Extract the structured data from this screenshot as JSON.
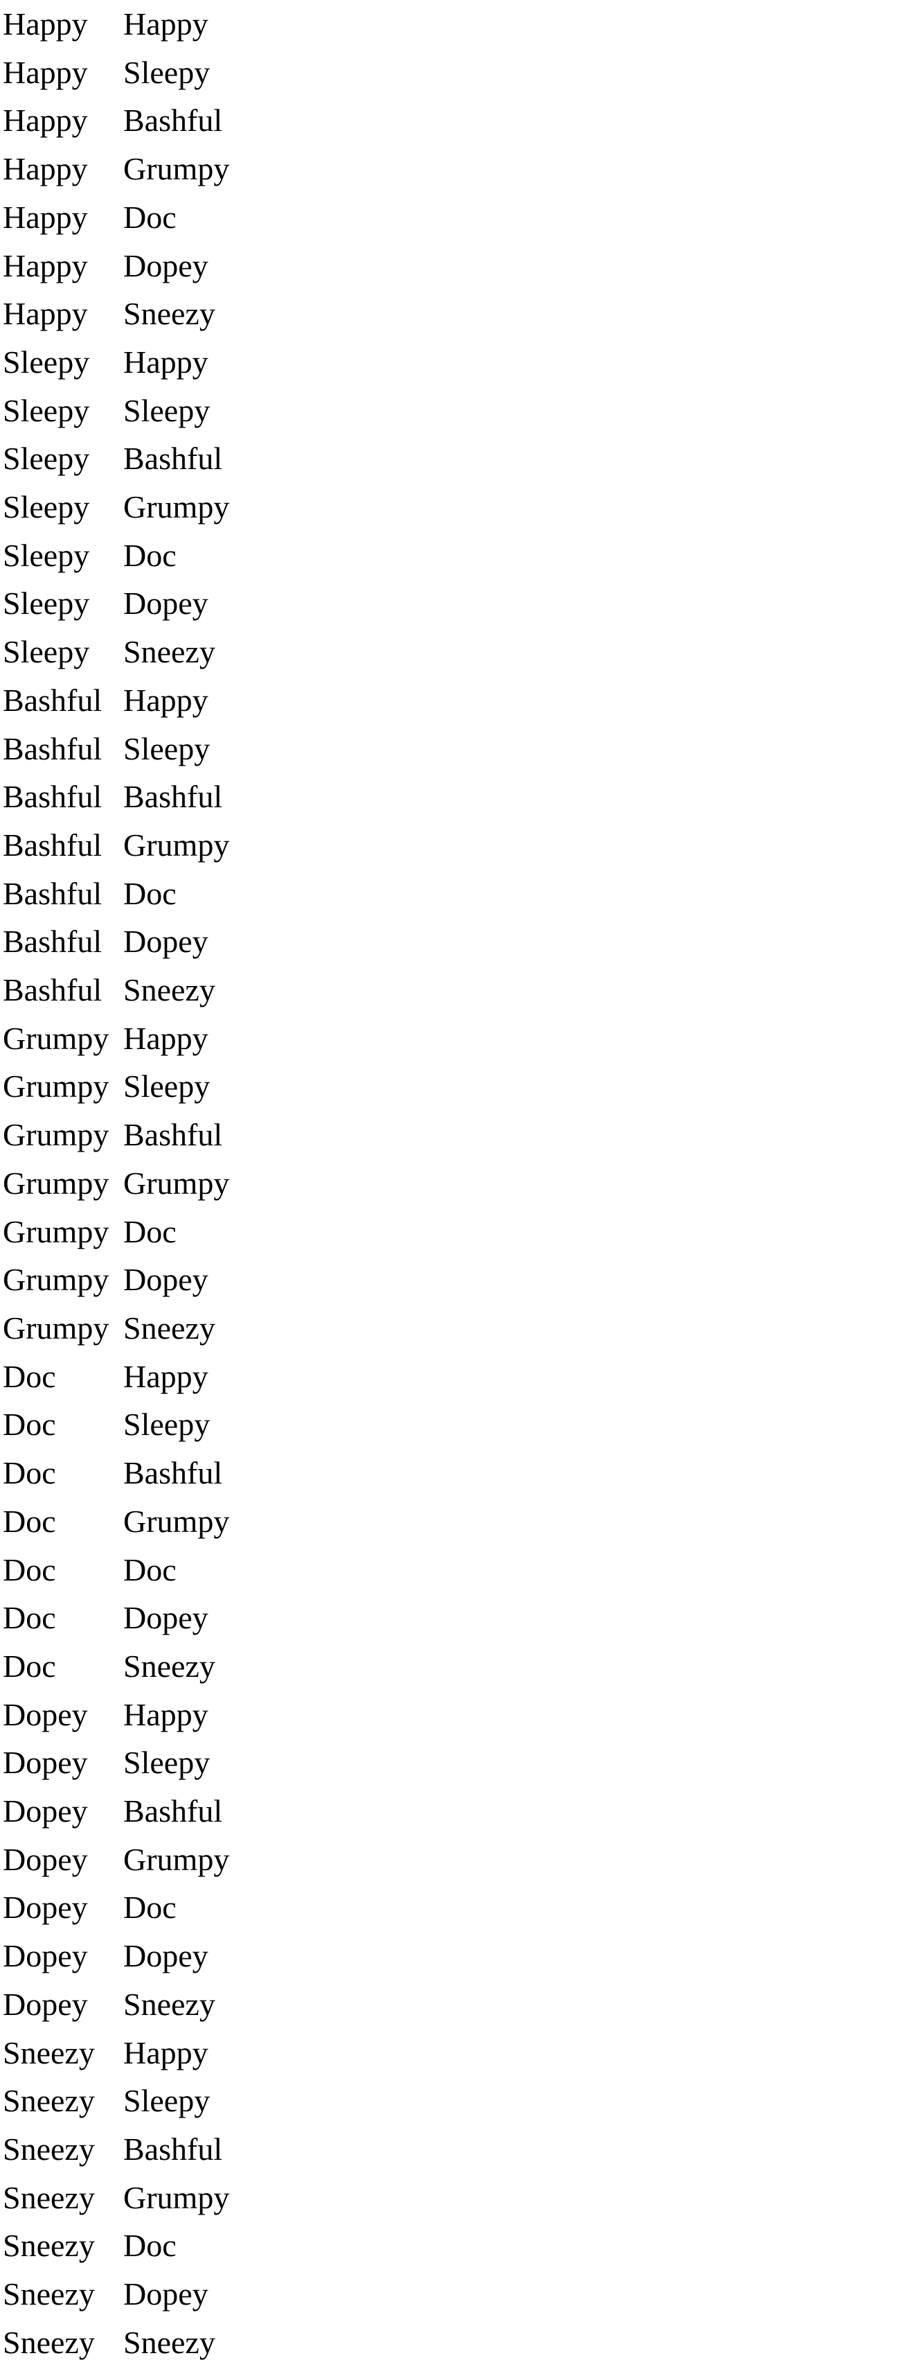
{
  "rows": [
    [
      "Happy",
      "Happy"
    ],
    [
      "Happy",
      "Sleepy"
    ],
    [
      "Happy",
      "Bashful"
    ],
    [
      "Happy",
      "Grumpy"
    ],
    [
      "Happy",
      "Doc"
    ],
    [
      "Happy",
      "Dopey"
    ],
    [
      "Happy",
      "Sneezy"
    ],
    [
      "Sleepy",
      "Happy"
    ],
    [
      "Sleepy",
      "Sleepy"
    ],
    [
      "Sleepy",
      "Bashful"
    ],
    [
      "Sleepy",
      "Grumpy"
    ],
    [
      "Sleepy",
      "Doc"
    ],
    [
      "Sleepy",
      "Dopey"
    ],
    [
      "Sleepy",
      "Sneezy"
    ],
    [
      "Bashful",
      "Happy"
    ],
    [
      "Bashful",
      "Sleepy"
    ],
    [
      "Bashful",
      "Bashful"
    ],
    [
      "Bashful",
      "Grumpy"
    ],
    [
      "Bashful",
      "Doc"
    ],
    [
      "Bashful",
      "Dopey"
    ],
    [
      "Bashful",
      "Sneezy"
    ],
    [
      "Grumpy",
      "Happy"
    ],
    [
      "Grumpy",
      "Sleepy"
    ],
    [
      "Grumpy",
      "Bashful"
    ],
    [
      "Grumpy",
      "Grumpy"
    ],
    [
      "Grumpy",
      "Doc"
    ],
    [
      "Grumpy",
      "Dopey"
    ],
    [
      "Grumpy",
      "Sneezy"
    ],
    [
      "Doc",
      "Happy"
    ],
    [
      "Doc",
      "Sleepy"
    ],
    [
      "Doc",
      "Bashful"
    ],
    [
      "Doc",
      "Grumpy"
    ],
    [
      "Doc",
      "Doc"
    ],
    [
      "Doc",
      "Dopey"
    ],
    [
      "Doc",
      "Sneezy"
    ],
    [
      "Dopey",
      "Happy"
    ],
    [
      "Dopey",
      "Sleepy"
    ],
    [
      "Dopey",
      "Bashful"
    ],
    [
      "Dopey",
      "Grumpy"
    ],
    [
      "Dopey",
      "Doc"
    ],
    [
      "Dopey",
      "Dopey"
    ],
    [
      "Dopey",
      "Sneezy"
    ],
    [
      "Sneezy",
      "Happy"
    ],
    [
      "Sneezy",
      "Sleepy"
    ],
    [
      "Sneezy",
      "Bashful"
    ],
    [
      "Sneezy",
      "Grumpy"
    ],
    [
      "Sneezy",
      "Doc"
    ],
    [
      "Sneezy",
      "Dopey"
    ],
    [
      "Sneezy",
      "Sneezy"
    ]
  ]
}
